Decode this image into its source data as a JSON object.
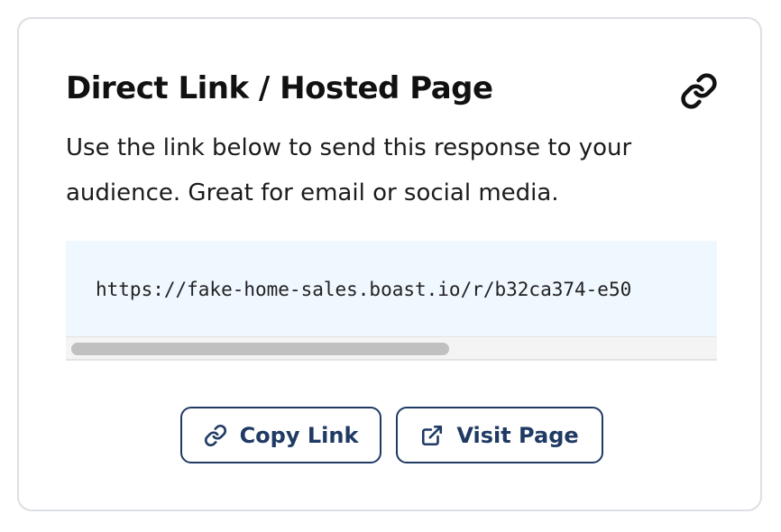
{
  "card": {
    "title": "Direct Link / Hosted Page",
    "description": "Use the link below to send this response to your audience. Great for email or social media.",
    "url": "https://fake-home-sales.boast.io/r/b32ca374-e50",
    "title_icon": "link-icon",
    "actions": {
      "copy_label": "Copy Link",
      "copy_icon": "link-icon",
      "visit_label": "Visit Page",
      "visit_icon": "external-link-icon"
    }
  },
  "colors": {
    "accent": "#1f3a63",
    "url_background": "#eff7ff",
    "card_border": "#dcdfe3"
  }
}
